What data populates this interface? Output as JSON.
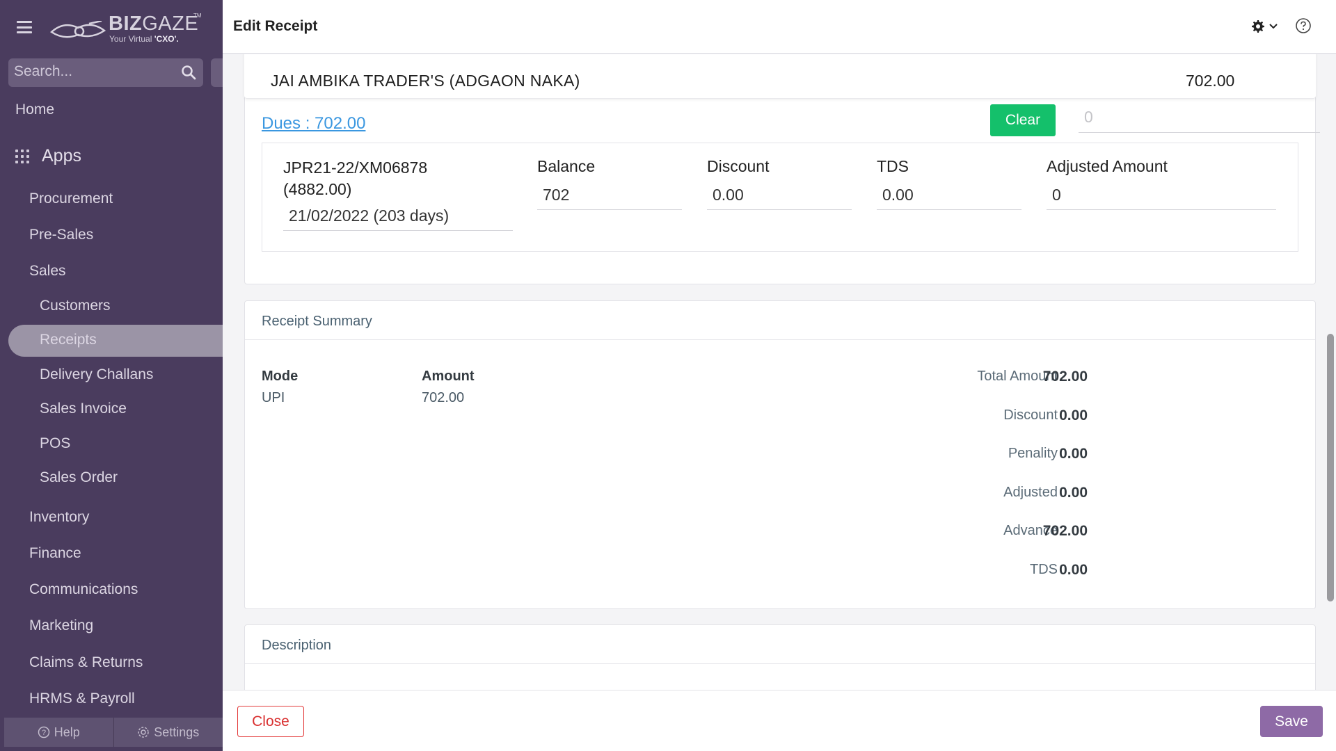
{
  "brand": {
    "name_bold": "BIZ",
    "name_light": "GAZE",
    "tm": "TM",
    "tagline_prefix": "Your Virtual ",
    "tagline_bold": "'CXO'."
  },
  "search": {
    "placeholder": "Search..."
  },
  "nav": {
    "home": "Home",
    "apps": "Apps",
    "items": [
      "Procurement",
      "Pre-Sales",
      "Sales",
      "Inventory",
      "Finance",
      "Communications",
      "Marketing",
      "Claims & Returns",
      "HRMS & Payroll"
    ],
    "sales_sub": [
      "Customers",
      "Receipts",
      "Delivery Challans",
      "Sales Invoice",
      "POS",
      "Sales Order"
    ],
    "active": "Receipts",
    "help": "Help",
    "settings": "Settings"
  },
  "header": {
    "title": "Edit Receipt"
  },
  "customer": {
    "name": "JAI AMBIKA TRADER'S (ADGAON NAKA)",
    "amount": "702.00"
  },
  "dues": {
    "label": "Dues : 702.00"
  },
  "clear_label": "Clear",
  "adjust_input": {
    "placeholder": "0",
    "value": ""
  },
  "invoice": {
    "number": "JPR21-22/XM06878",
    "total": "(4882.00)",
    "date": "21/02/2022 (203 days)",
    "balance_label": "Balance",
    "balance_value": "702",
    "discount_label": "Discount",
    "discount_value": "0.00",
    "tds_label": "TDS",
    "tds_value": "0.00",
    "adjusted_label": "Adjusted Amount",
    "adjusted_value": "0"
  },
  "summary": {
    "title": "Receipt Summary",
    "mode_header": "Mode",
    "amount_header": "Amount",
    "mode_value": "UPI",
    "amount_value": "702.00",
    "totals": [
      {
        "label": "Total Amount",
        "value": "702.00"
      },
      {
        "label": "Discount",
        "value": "0.00"
      },
      {
        "label": "Penality",
        "value": "0.00"
      },
      {
        "label": "Adjusted",
        "value": "0.00"
      },
      {
        "label": "Advance",
        "value": "702.00"
      },
      {
        "label": "TDS",
        "value": "0.00"
      }
    ]
  },
  "description": {
    "title": "Description"
  },
  "footer": {
    "close_label": "Close",
    "save_label": "Save"
  }
}
